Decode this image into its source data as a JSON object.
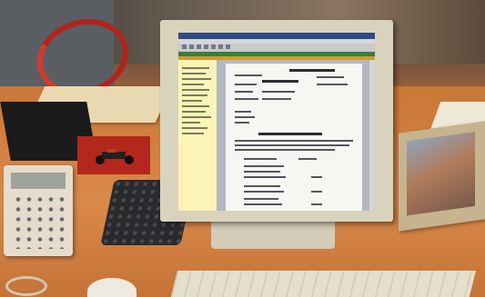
{
  "scene": {
    "description_items": [
      "monitor",
      "desk-phone",
      "keypad",
      "picture-frame",
      "keyboard",
      "cup"
    ]
  },
  "colors": {
    "desk": "#c97738",
    "monitor_bezel": "#d9d2bd",
    "screen_titlebar": "#2e4a85",
    "screen_greenbar": "#3b7e38",
    "screen_sidebar": "#fcf4b7"
  }
}
